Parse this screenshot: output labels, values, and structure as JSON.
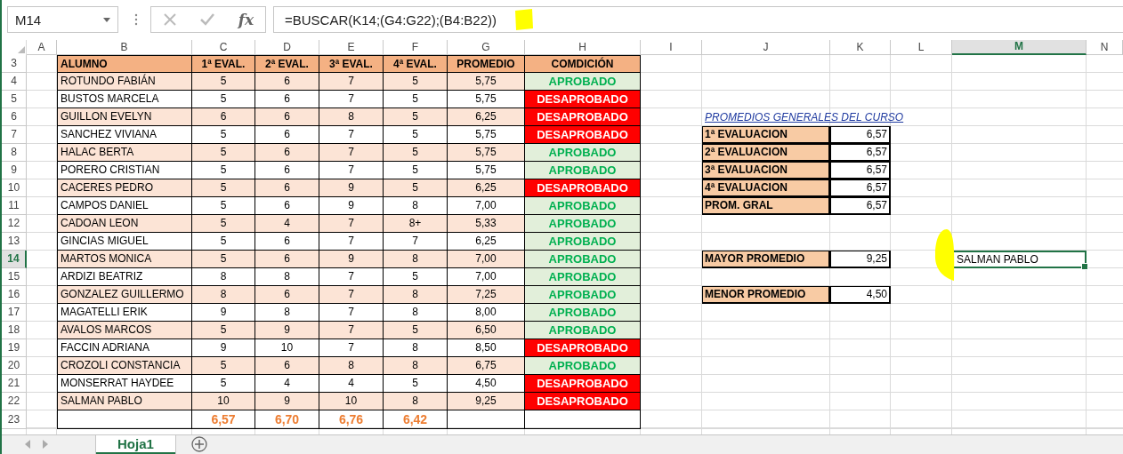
{
  "name_box": "M14",
  "function_button": "fx",
  "formula": "=BUSCAR(K14;(G4:G22);(B4:B22))",
  "column_headers": [
    {
      "label": "A",
      "selected": false
    },
    {
      "label": "B",
      "selected": false
    },
    {
      "label": "C",
      "selected": false
    },
    {
      "label": "D",
      "selected": false
    },
    {
      "label": "E",
      "selected": false
    },
    {
      "label": "F",
      "selected": false
    },
    {
      "label": "G",
      "selected": false
    },
    {
      "label": "H",
      "selected": false
    },
    {
      "label": "I",
      "selected": false
    },
    {
      "label": "J",
      "selected": false
    },
    {
      "label": "K",
      "selected": false
    },
    {
      "label": "L",
      "selected": false
    },
    {
      "label": "M",
      "selected": true
    },
    {
      "label": "N",
      "selected": false
    }
  ],
  "row_numbers": [
    {
      "label": "3",
      "selected": false
    },
    {
      "label": "4",
      "selected": false
    },
    {
      "label": "5",
      "selected": false
    },
    {
      "label": "6",
      "selected": false
    },
    {
      "label": "7",
      "selected": false
    },
    {
      "label": "8",
      "selected": false
    },
    {
      "label": "9",
      "selected": false
    },
    {
      "label": "10",
      "selected": false
    },
    {
      "label": "11",
      "selected": false
    },
    {
      "label": "12",
      "selected": false
    },
    {
      "label": "13",
      "selected": false
    },
    {
      "label": "14",
      "selected": true
    },
    {
      "label": "15",
      "selected": false
    },
    {
      "label": "16",
      "selected": false
    },
    {
      "label": "17",
      "selected": false
    },
    {
      "label": "18",
      "selected": false
    },
    {
      "label": "19",
      "selected": false
    },
    {
      "label": "20",
      "selected": false
    },
    {
      "label": "21",
      "selected": false
    },
    {
      "label": "22",
      "selected": false
    },
    {
      "label": "23",
      "selected": false
    }
  ],
  "table": {
    "columns": [
      "ALUMNO",
      "1ª EVAL.",
      "2ª EVAL.",
      "3ª EVAL.",
      "4ª EVAL.",
      "PROMEDIO",
      "COMDICIÓN"
    ],
    "rows": [
      {
        "name": "ROTUNDO FABIÁN",
        "grades": [
          "5",
          "6",
          "7",
          "5"
        ],
        "average": "5,75",
        "condition": "APROBADO",
        "passed": true
      },
      {
        "name": "BUSTOS MARCELA",
        "grades": [
          "5",
          "6",
          "7",
          "5"
        ],
        "average": "5,75",
        "condition": "DESAPROBADO",
        "passed": false
      },
      {
        "name": "GUILLON EVELYN",
        "grades": [
          "6",
          "6",
          "8",
          "5"
        ],
        "average": "6,25",
        "condition": "DESAPROBADO",
        "passed": false
      },
      {
        "name": "SANCHEZ VIVIANA",
        "grades": [
          "5",
          "6",
          "7",
          "5"
        ],
        "average": "5,75",
        "condition": "DESAPROBADO",
        "passed": false
      },
      {
        "name": "HALAC BERTA",
        "grades": [
          "5",
          "6",
          "7",
          "5"
        ],
        "average": "5,75",
        "condition": "APROBADO",
        "passed": true
      },
      {
        "name": "PORERO CRISTIAN",
        "grades": [
          "5",
          "6",
          "7",
          "5"
        ],
        "average": "5,75",
        "condition": "APROBADO",
        "passed": true
      },
      {
        "name": "CACERES PEDRO",
        "grades": [
          "5",
          "6",
          "9",
          "5"
        ],
        "average": "6,25",
        "condition": "DESAPROBADO",
        "passed": false
      },
      {
        "name": "CAMPOS DANIEL",
        "grades": [
          "5",
          "6",
          "9",
          "8"
        ],
        "average": "7,00",
        "condition": "APROBADO",
        "passed": true
      },
      {
        "name": "CADOAN LEON",
        "grades": [
          "5",
          "4",
          "7",
          "8+"
        ],
        "average": "5,33",
        "condition": "APROBADO",
        "passed": true
      },
      {
        "name": "GINCIAS MIGUEL",
        "grades": [
          "5",
          "6",
          "7",
          "7"
        ],
        "average": "6,25",
        "condition": "APROBADO",
        "passed": true
      },
      {
        "name": "MARTOS MONICA",
        "grades": [
          "5",
          "6",
          "9",
          "8"
        ],
        "average": "7,00",
        "condition": "APROBADO",
        "passed": true
      },
      {
        "name": "ARDIZI BEATRIZ",
        "grades": [
          "8",
          "8",
          "7",
          "5"
        ],
        "average": "7,00",
        "condition": "APROBADO",
        "passed": true
      },
      {
        "name": "GONZALEZ GUILLERMO",
        "grades": [
          "8",
          "6",
          "7",
          "8"
        ],
        "average": "7,25",
        "condition": "APROBADO",
        "passed": true
      },
      {
        "name": "MAGATELLI ERIK",
        "grades": [
          "9",
          "8",
          "7",
          "8"
        ],
        "average": "8,00",
        "condition": "APROBADO",
        "passed": true
      },
      {
        "name": "AVALOS MARCOS",
        "grades": [
          "5",
          "9",
          "7",
          "5"
        ],
        "average": "6,50",
        "condition": "APROBADO",
        "passed": true
      },
      {
        "name": "FACCIN ADRIANA",
        "grades": [
          "9",
          "10",
          "7",
          "8"
        ],
        "average": "8,50",
        "condition": "DESAPROBADO",
        "passed": false
      },
      {
        "name": "CROZOLI CONSTANCIA",
        "grades": [
          "5",
          "6",
          "8",
          "8"
        ],
        "average": "6,75",
        "condition": "APROBADO",
        "passed": true
      },
      {
        "name": "MONSERRAT HAYDEE",
        "grades": [
          "5",
          "4",
          "4",
          "5"
        ],
        "average": "4,50",
        "condition": "DESAPROBADO",
        "passed": false
      },
      {
        "name": "SALMAN PABLO",
        "grades": [
          "10",
          "9",
          "10",
          "8"
        ],
        "average": "9,25",
        "condition": "DESAPROBADO",
        "passed": false
      }
    ],
    "totals": [
      "6,57",
      "6,70",
      "6,76",
      "6,42"
    ]
  },
  "summary": {
    "title": "PROMEDIOS GENERALES DEL CURSO",
    "items": [
      {
        "label": "1ª EVALUACION",
        "value": "6,57"
      },
      {
        "label": "2ª EVALUACION",
        "value": "6,57"
      },
      {
        "label": "3ª EVALUACION",
        "value": "6,57"
      },
      {
        "label": "4ª EVALUACION",
        "value": "6,57"
      },
      {
        "label": "PROM. GRAL",
        "value": "6,57"
      }
    ],
    "max": {
      "label": "MAYOR PROMEDIO",
      "value": "9,25"
    },
    "min": {
      "label": "MENOR PROMEDIO",
      "value": "4,50"
    }
  },
  "active_cell": {
    "value": "SALMAN PABLO"
  },
  "sheet_tabs": [
    {
      "label": "Hoja1",
      "selected": true
    }
  ]
}
